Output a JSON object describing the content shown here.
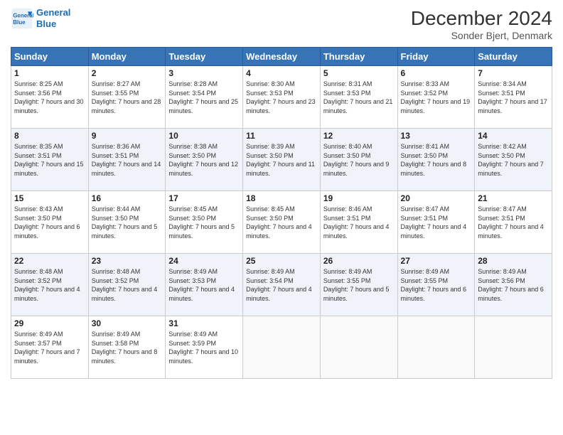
{
  "header": {
    "logo": {
      "line1": "General",
      "line2": "Blue"
    },
    "title": "December 2024",
    "location": "Sonder Bjert, Denmark"
  },
  "days_of_week": [
    "Sunday",
    "Monday",
    "Tuesday",
    "Wednesday",
    "Thursday",
    "Friday",
    "Saturday"
  ],
  "weeks": [
    [
      {
        "num": "1",
        "sunrise": "8:25 AM",
        "sunset": "3:56 PM",
        "daylight": "7 hours and 30 minutes."
      },
      {
        "num": "2",
        "sunrise": "8:27 AM",
        "sunset": "3:55 PM",
        "daylight": "7 hours and 28 minutes."
      },
      {
        "num": "3",
        "sunrise": "8:28 AM",
        "sunset": "3:54 PM",
        "daylight": "7 hours and 25 minutes."
      },
      {
        "num": "4",
        "sunrise": "8:30 AM",
        "sunset": "3:53 PM",
        "daylight": "7 hours and 23 minutes."
      },
      {
        "num": "5",
        "sunrise": "8:31 AM",
        "sunset": "3:53 PM",
        "daylight": "7 hours and 21 minutes."
      },
      {
        "num": "6",
        "sunrise": "8:33 AM",
        "sunset": "3:52 PM",
        "daylight": "7 hours and 19 minutes."
      },
      {
        "num": "7",
        "sunrise": "8:34 AM",
        "sunset": "3:51 PM",
        "daylight": "7 hours and 17 minutes."
      }
    ],
    [
      {
        "num": "8",
        "sunrise": "8:35 AM",
        "sunset": "3:51 PM",
        "daylight": "7 hours and 15 minutes."
      },
      {
        "num": "9",
        "sunrise": "8:36 AM",
        "sunset": "3:51 PM",
        "daylight": "7 hours and 14 minutes."
      },
      {
        "num": "10",
        "sunrise": "8:38 AM",
        "sunset": "3:50 PM",
        "daylight": "7 hours and 12 minutes."
      },
      {
        "num": "11",
        "sunrise": "8:39 AM",
        "sunset": "3:50 PM",
        "daylight": "7 hours and 11 minutes."
      },
      {
        "num": "12",
        "sunrise": "8:40 AM",
        "sunset": "3:50 PM",
        "daylight": "7 hours and 9 minutes."
      },
      {
        "num": "13",
        "sunrise": "8:41 AM",
        "sunset": "3:50 PM",
        "daylight": "7 hours and 8 minutes."
      },
      {
        "num": "14",
        "sunrise": "8:42 AM",
        "sunset": "3:50 PM",
        "daylight": "7 hours and 7 minutes."
      }
    ],
    [
      {
        "num": "15",
        "sunrise": "8:43 AM",
        "sunset": "3:50 PM",
        "daylight": "7 hours and 6 minutes."
      },
      {
        "num": "16",
        "sunrise": "8:44 AM",
        "sunset": "3:50 PM",
        "daylight": "7 hours and 5 minutes."
      },
      {
        "num": "17",
        "sunrise": "8:45 AM",
        "sunset": "3:50 PM",
        "daylight": "7 hours and 5 minutes."
      },
      {
        "num": "18",
        "sunrise": "8:45 AM",
        "sunset": "3:50 PM",
        "daylight": "7 hours and 4 minutes."
      },
      {
        "num": "19",
        "sunrise": "8:46 AM",
        "sunset": "3:51 PM",
        "daylight": "7 hours and 4 minutes."
      },
      {
        "num": "20",
        "sunrise": "8:47 AM",
        "sunset": "3:51 PM",
        "daylight": "7 hours and 4 minutes."
      },
      {
        "num": "21",
        "sunrise": "8:47 AM",
        "sunset": "3:51 PM",
        "daylight": "7 hours and 4 minutes."
      }
    ],
    [
      {
        "num": "22",
        "sunrise": "8:48 AM",
        "sunset": "3:52 PM",
        "daylight": "7 hours and 4 minutes."
      },
      {
        "num": "23",
        "sunrise": "8:48 AM",
        "sunset": "3:52 PM",
        "daylight": "7 hours and 4 minutes."
      },
      {
        "num": "24",
        "sunrise": "8:49 AM",
        "sunset": "3:53 PM",
        "daylight": "7 hours and 4 minutes."
      },
      {
        "num": "25",
        "sunrise": "8:49 AM",
        "sunset": "3:54 PM",
        "daylight": "7 hours and 4 minutes."
      },
      {
        "num": "26",
        "sunrise": "8:49 AM",
        "sunset": "3:55 PM",
        "daylight": "7 hours and 5 minutes."
      },
      {
        "num": "27",
        "sunrise": "8:49 AM",
        "sunset": "3:55 PM",
        "daylight": "7 hours and 6 minutes."
      },
      {
        "num": "28",
        "sunrise": "8:49 AM",
        "sunset": "3:56 PM",
        "daylight": "7 hours and 6 minutes."
      }
    ],
    [
      {
        "num": "29",
        "sunrise": "8:49 AM",
        "sunset": "3:57 PM",
        "daylight": "7 hours and 7 minutes."
      },
      {
        "num": "30",
        "sunrise": "8:49 AM",
        "sunset": "3:58 PM",
        "daylight": "7 hours and 8 minutes."
      },
      {
        "num": "31",
        "sunrise": "8:49 AM",
        "sunset": "3:59 PM",
        "daylight": "7 hours and 10 minutes."
      },
      null,
      null,
      null,
      null
    ]
  ]
}
